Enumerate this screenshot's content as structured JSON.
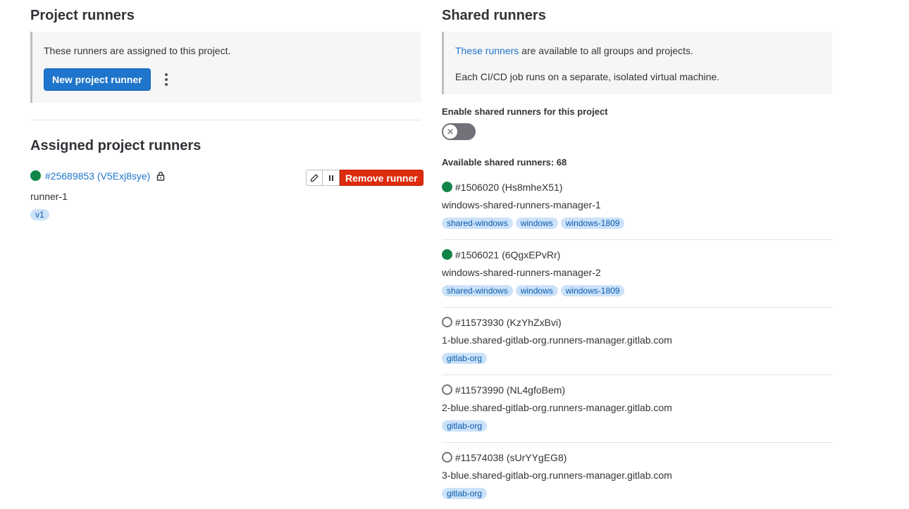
{
  "project_runners": {
    "title": "Project runners",
    "description": "These runners are assigned to this project.",
    "new_runner_label": "New project runner"
  },
  "assigned": {
    "title": "Assigned project runners",
    "runner": {
      "id_label": "#25689853 (V5Exj8sye)",
      "name": "runner-1",
      "tags": [
        "v1"
      ],
      "status": "online",
      "remove_label": "Remove runner"
    }
  },
  "shared_runners": {
    "title": "Shared runners",
    "desc_link": "These runners",
    "desc_rest": " are available to all groups and projects.",
    "desc_2": "Each CI/CD job runs on a separate, isolated virtual machine.",
    "enable_label": "Enable shared runners for this project",
    "toggle_state": "off",
    "available_label": "Available shared runners: 68",
    "runners": [
      {
        "id_label": "#1506020 (Hs8mheX51)",
        "name": "windows-shared-runners-manager-1",
        "status": "online",
        "tags": [
          "shared-windows",
          "windows",
          "windows-1809"
        ]
      },
      {
        "id_label": "#1506021 (6QgxEPvRr)",
        "name": "windows-shared-runners-manager-2",
        "status": "online",
        "tags": [
          "shared-windows",
          "windows",
          "windows-1809"
        ]
      },
      {
        "id_label": "#11573930 (KzYhZxBvi)",
        "name": "1-blue.shared-gitlab-org.runners-manager.gitlab.com",
        "status": "offline",
        "tags": [
          "gitlab-org"
        ]
      },
      {
        "id_label": "#11573990 (NL4gfoBem)",
        "name": "2-blue.shared-gitlab-org.runners-manager.gitlab.com",
        "status": "offline",
        "tags": [
          "gitlab-org"
        ]
      },
      {
        "id_label": "#11574038 (sUrYYgEG8)",
        "name": "3-blue.shared-gitlab-org.runners-manager.gitlab.com",
        "status": "offline",
        "tags": [
          "gitlab-org"
        ]
      }
    ]
  },
  "colors": {
    "primary": "#1f75cb",
    "danger": "#dd2b0e",
    "online": "#108548",
    "tag_bg": "#cbe2f9"
  }
}
